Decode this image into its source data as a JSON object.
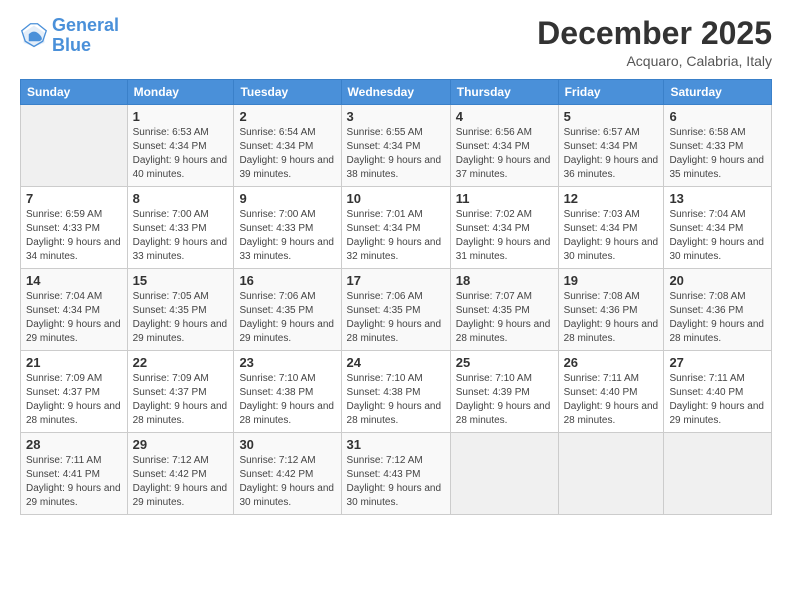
{
  "logo": {
    "line1": "General",
    "line2": "Blue"
  },
  "header": {
    "title": "December 2025",
    "location": "Acquaro, Calabria, Italy"
  },
  "days_of_week": [
    "Sunday",
    "Monday",
    "Tuesday",
    "Wednesday",
    "Thursday",
    "Friday",
    "Saturday"
  ],
  "weeks": [
    [
      {
        "day": "",
        "sunrise": "",
        "sunset": "",
        "daylight": ""
      },
      {
        "day": "1",
        "sunrise": "Sunrise: 6:53 AM",
        "sunset": "Sunset: 4:34 PM",
        "daylight": "Daylight: 9 hours and 40 minutes."
      },
      {
        "day": "2",
        "sunrise": "Sunrise: 6:54 AM",
        "sunset": "Sunset: 4:34 PM",
        "daylight": "Daylight: 9 hours and 39 minutes."
      },
      {
        "day": "3",
        "sunrise": "Sunrise: 6:55 AM",
        "sunset": "Sunset: 4:34 PM",
        "daylight": "Daylight: 9 hours and 38 minutes."
      },
      {
        "day": "4",
        "sunrise": "Sunrise: 6:56 AM",
        "sunset": "Sunset: 4:34 PM",
        "daylight": "Daylight: 9 hours and 37 minutes."
      },
      {
        "day": "5",
        "sunrise": "Sunrise: 6:57 AM",
        "sunset": "Sunset: 4:34 PM",
        "daylight": "Daylight: 9 hours and 36 minutes."
      },
      {
        "day": "6",
        "sunrise": "Sunrise: 6:58 AM",
        "sunset": "Sunset: 4:33 PM",
        "daylight": "Daylight: 9 hours and 35 minutes."
      }
    ],
    [
      {
        "day": "7",
        "sunrise": "Sunrise: 6:59 AM",
        "sunset": "Sunset: 4:33 PM",
        "daylight": "Daylight: 9 hours and 34 minutes."
      },
      {
        "day": "8",
        "sunrise": "Sunrise: 7:00 AM",
        "sunset": "Sunset: 4:33 PM",
        "daylight": "Daylight: 9 hours and 33 minutes."
      },
      {
        "day": "9",
        "sunrise": "Sunrise: 7:00 AM",
        "sunset": "Sunset: 4:33 PM",
        "daylight": "Daylight: 9 hours and 33 minutes."
      },
      {
        "day": "10",
        "sunrise": "Sunrise: 7:01 AM",
        "sunset": "Sunset: 4:34 PM",
        "daylight": "Daylight: 9 hours and 32 minutes."
      },
      {
        "day": "11",
        "sunrise": "Sunrise: 7:02 AM",
        "sunset": "Sunset: 4:34 PM",
        "daylight": "Daylight: 9 hours and 31 minutes."
      },
      {
        "day": "12",
        "sunrise": "Sunrise: 7:03 AM",
        "sunset": "Sunset: 4:34 PM",
        "daylight": "Daylight: 9 hours and 30 minutes."
      },
      {
        "day": "13",
        "sunrise": "Sunrise: 7:04 AM",
        "sunset": "Sunset: 4:34 PM",
        "daylight": "Daylight: 9 hours and 30 minutes."
      }
    ],
    [
      {
        "day": "14",
        "sunrise": "Sunrise: 7:04 AM",
        "sunset": "Sunset: 4:34 PM",
        "daylight": "Daylight: 9 hours and 29 minutes."
      },
      {
        "day": "15",
        "sunrise": "Sunrise: 7:05 AM",
        "sunset": "Sunset: 4:35 PM",
        "daylight": "Daylight: 9 hours and 29 minutes."
      },
      {
        "day": "16",
        "sunrise": "Sunrise: 7:06 AM",
        "sunset": "Sunset: 4:35 PM",
        "daylight": "Daylight: 9 hours and 29 minutes."
      },
      {
        "day": "17",
        "sunrise": "Sunrise: 7:06 AM",
        "sunset": "Sunset: 4:35 PM",
        "daylight": "Daylight: 9 hours and 28 minutes."
      },
      {
        "day": "18",
        "sunrise": "Sunrise: 7:07 AM",
        "sunset": "Sunset: 4:35 PM",
        "daylight": "Daylight: 9 hours and 28 minutes."
      },
      {
        "day": "19",
        "sunrise": "Sunrise: 7:08 AM",
        "sunset": "Sunset: 4:36 PM",
        "daylight": "Daylight: 9 hours and 28 minutes."
      },
      {
        "day": "20",
        "sunrise": "Sunrise: 7:08 AM",
        "sunset": "Sunset: 4:36 PM",
        "daylight": "Daylight: 9 hours and 28 minutes."
      }
    ],
    [
      {
        "day": "21",
        "sunrise": "Sunrise: 7:09 AM",
        "sunset": "Sunset: 4:37 PM",
        "daylight": "Daylight: 9 hours and 28 minutes."
      },
      {
        "day": "22",
        "sunrise": "Sunrise: 7:09 AM",
        "sunset": "Sunset: 4:37 PM",
        "daylight": "Daylight: 9 hours and 28 minutes."
      },
      {
        "day": "23",
        "sunrise": "Sunrise: 7:10 AM",
        "sunset": "Sunset: 4:38 PM",
        "daylight": "Daylight: 9 hours and 28 minutes."
      },
      {
        "day": "24",
        "sunrise": "Sunrise: 7:10 AM",
        "sunset": "Sunset: 4:38 PM",
        "daylight": "Daylight: 9 hours and 28 minutes."
      },
      {
        "day": "25",
        "sunrise": "Sunrise: 7:10 AM",
        "sunset": "Sunset: 4:39 PM",
        "daylight": "Daylight: 9 hours and 28 minutes."
      },
      {
        "day": "26",
        "sunrise": "Sunrise: 7:11 AM",
        "sunset": "Sunset: 4:40 PM",
        "daylight": "Daylight: 9 hours and 28 minutes."
      },
      {
        "day": "27",
        "sunrise": "Sunrise: 7:11 AM",
        "sunset": "Sunset: 4:40 PM",
        "daylight": "Daylight: 9 hours and 29 minutes."
      }
    ],
    [
      {
        "day": "28",
        "sunrise": "Sunrise: 7:11 AM",
        "sunset": "Sunset: 4:41 PM",
        "daylight": "Daylight: 9 hours and 29 minutes."
      },
      {
        "day": "29",
        "sunrise": "Sunrise: 7:12 AM",
        "sunset": "Sunset: 4:42 PM",
        "daylight": "Daylight: 9 hours and 29 minutes."
      },
      {
        "day": "30",
        "sunrise": "Sunrise: 7:12 AM",
        "sunset": "Sunset: 4:42 PM",
        "daylight": "Daylight: 9 hours and 30 minutes."
      },
      {
        "day": "31",
        "sunrise": "Sunrise: 7:12 AM",
        "sunset": "Sunset: 4:43 PM",
        "daylight": "Daylight: 9 hours and 30 minutes."
      },
      {
        "day": "",
        "sunrise": "",
        "sunset": "",
        "daylight": ""
      },
      {
        "day": "",
        "sunrise": "",
        "sunset": "",
        "daylight": ""
      },
      {
        "day": "",
        "sunrise": "",
        "sunset": "",
        "daylight": ""
      }
    ]
  ]
}
